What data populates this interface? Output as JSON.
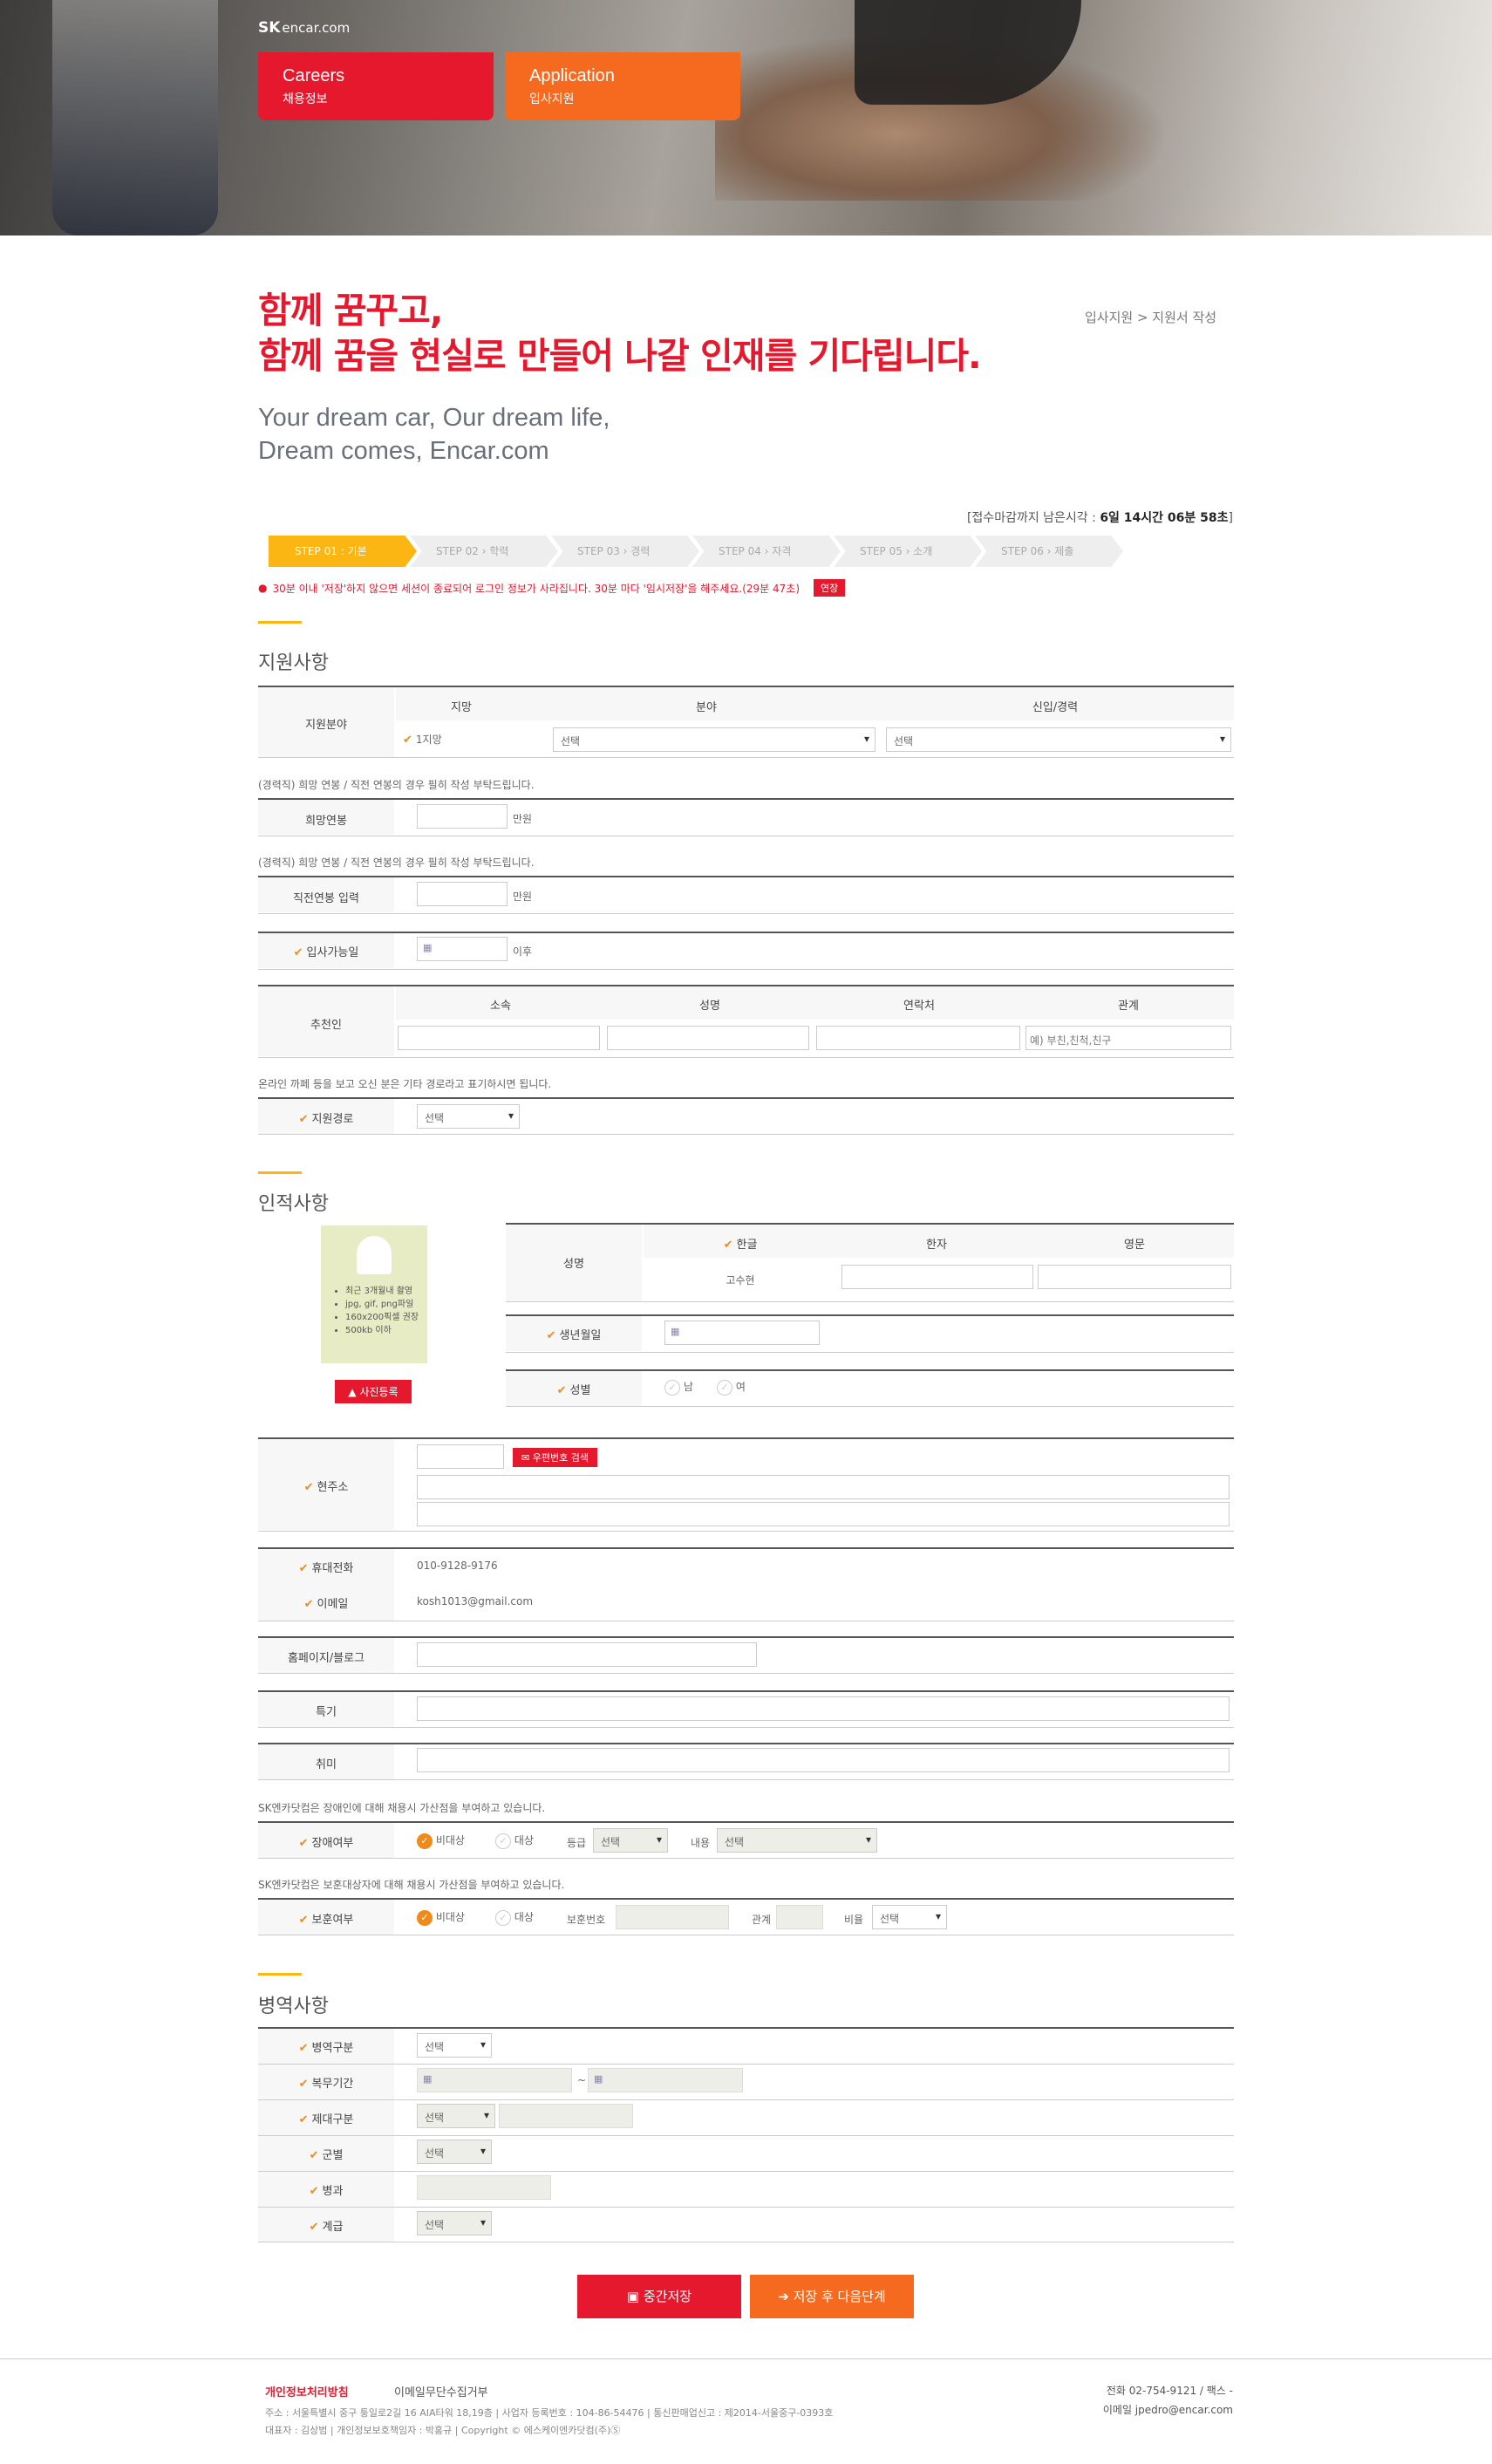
{
  "header": {
    "logo_sk": "SK",
    "logo_text": "encar.com",
    "nav": [
      {
        "title": "Careers",
        "sub": "채용정보"
      },
      {
        "title": "Application",
        "sub": "입사지원"
      }
    ]
  },
  "headline": {
    "ko1": "함께 꿈꾸고,",
    "ko2": "함께 꿈을 현실로 만들어 나갈 인재를 기다립니다.",
    "en1": "Your dream car, Our dream life,",
    "en2": "Dream comes, Encar.com"
  },
  "breadcrumb": "입사지원 > 지원서 작성",
  "timer": {
    "prefix": "[접수마감까지 남은시각 : ",
    "value": "6일 14시간 06분 58초",
    "suffix": "]"
  },
  "steps": [
    "STEP 01 : 기본",
    "STEP 02 › 학력",
    "STEP 03 › 경력",
    "STEP 04 › 자격",
    "STEP 05 › 소개",
    "STEP 06 › 제출"
  ],
  "warning": {
    "text": "30분 이내 '저장'하지 않으면 세션이 종료되어 로그인 정보가 사라집니다. 30분 마다 '임시저장'을 해주세요.(29분 47초)",
    "extend": "연장"
  },
  "apply": {
    "title": "지원사항",
    "field_label": "지원분야",
    "cols": [
      "지망",
      "분야",
      "신입/경력"
    ],
    "choice": "1지망",
    "sel1": "선택",
    "sel2": "선택",
    "note1": "(경력직) 희망 연봉 / 직전 연봉의 경우 필히 작성 부탁드립니다.",
    "salary_label": "희망연봉",
    "unit": "만원",
    "note2": "(경력직) 희망 연봉 / 직전 연봉의 경우 필히 작성 부탁드립니다.",
    "prev_label": "직전연봉 입력",
    "unit2": "만원",
    "join_label": "입사가능일",
    "after": "이후",
    "ref_label": "추천인",
    "ref_cols": [
      "소속",
      "성명",
      "연락처",
      "관계"
    ],
    "ref_placeholder": "예) 부친,친척,친구",
    "note3": "온라인 까페 등을 보고 오신 분은 기타 경로라고 표기하시면 됩니다.",
    "route_label": "지원경로",
    "route_sel": "선택"
  },
  "personal": {
    "title": "인적사항",
    "photo_tips": [
      "최근 3개월내 촬영",
      "jpg, gif, png파일",
      "160x200픽셀 권장",
      "500kb 이하"
    ],
    "photo_btn": "사진등록",
    "name_label": "성명",
    "name_cols": [
      "한글",
      "한자",
      "영문"
    ],
    "name_ko": "고수현",
    "birth_label": "생년월일",
    "gender_label": "성별",
    "male": "남",
    "female": "여",
    "addr_label": "현주소",
    "zip_btn": "우편번호 검색",
    "phone_label": "휴대전화",
    "phone": "010-9128-9176",
    "email_label": "이메일",
    "email": "kosh1013@gmail.com",
    "home_label": "홈페이지/블로그",
    "skill_label": "특기",
    "hobby_label": "취미",
    "note_dis": "SK엔카닷컴은 장애인에 대해 채용시 가산점을 부여하고 있습니다.",
    "dis_label": "장애여부",
    "no": "비대상",
    "yes": "대상",
    "grade": "등급",
    "grade_sel": "선택",
    "content": "내용",
    "content_sel": "선택",
    "note_vet": "SK엔카닷컴은 보훈대상자에 대해 채용시 가산점을 부여하고 있습니다.",
    "vet_label": "보훈여부",
    "no2": "비대상",
    "yes2": "대상",
    "vet_no": "보훈번호",
    "relation": "관계",
    "ratio": "비율",
    "ratio_sel": "선택"
  },
  "military": {
    "title": "병역사항",
    "type_label": "병역구분",
    "type_sel": "선택",
    "period_label": "복무기간",
    "tilde": "~",
    "discharge_label": "제대구분",
    "discharge_sel": "선택",
    "branch_label": "군별",
    "branch_sel": "선택",
    "arm_label": "병과",
    "rank_label": "계급",
    "rank_sel": "선택"
  },
  "buttons": {
    "save": "중간저장",
    "next": "저장 후 다음단계"
  },
  "footer": {
    "privacy": "개인정보처리방침",
    "email_refuse": "이메일무단수집거부",
    "addr": "주소 : 서울특별시 중구 퉁일로2길 16 AIA타워 18,19층  |  사업자 등록번호 : 104-86-54476  |  통신판매업신고 : 제2014-서울중구-0393호",
    "rep": "대표자 : 김상범  |  개인정보보호책임자 : 박홍규  |  Copyright © 에스케이엔카닷컴(주)Ⓢ",
    "tel": "전화 02-754-9121 / 팩스 -",
    "mail": "이메일 jpedro@encar.com"
  }
}
